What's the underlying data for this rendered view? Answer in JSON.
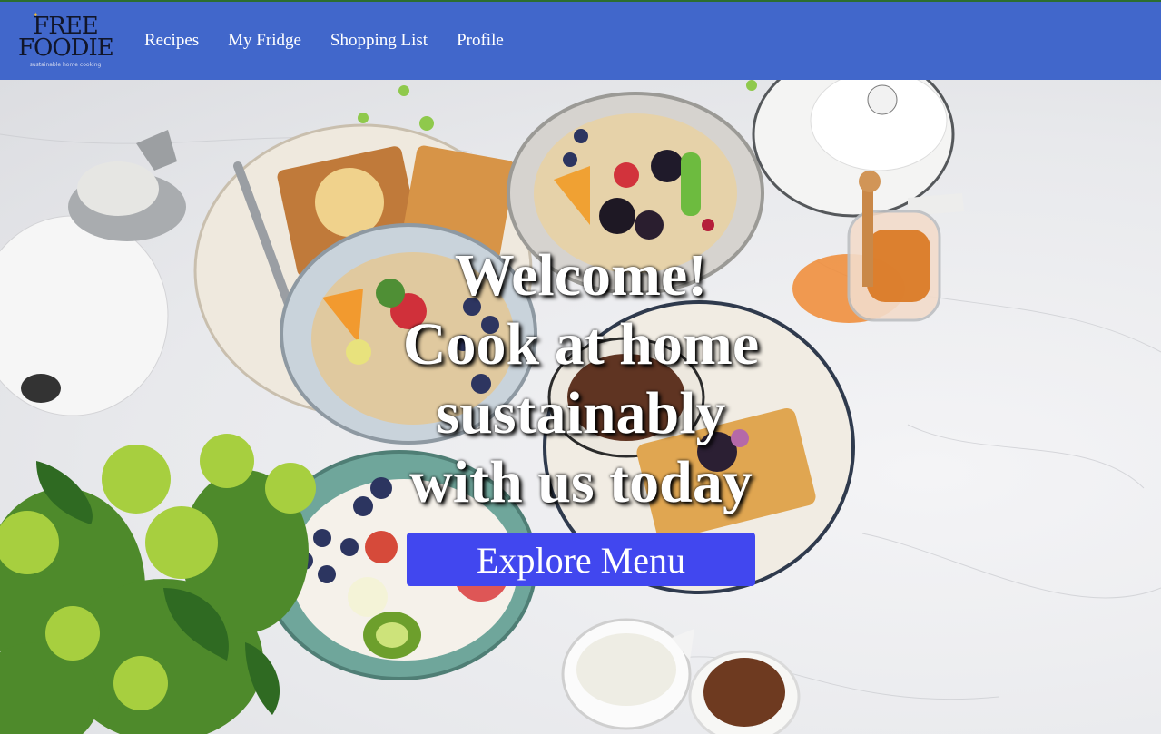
{
  "app": {
    "logo": {
      "line1": "FREE",
      "line2": "FOODIE",
      "tagline": "sustainable home cooking"
    },
    "brand_color": "#4167cb",
    "accent_color": "#4147ef"
  },
  "nav": {
    "items": [
      {
        "label": "Recipes"
      },
      {
        "label": "My Fridge"
      },
      {
        "label": "Shopping List"
      },
      {
        "label": "Profile"
      }
    ]
  },
  "hero": {
    "headline": [
      "Welcome!",
      "Cook at home",
      "sustainably",
      "with us today"
    ],
    "cta_label": "Explore Menu",
    "background": "photo of breakfast bowls, waffles and flowers on marble table"
  }
}
